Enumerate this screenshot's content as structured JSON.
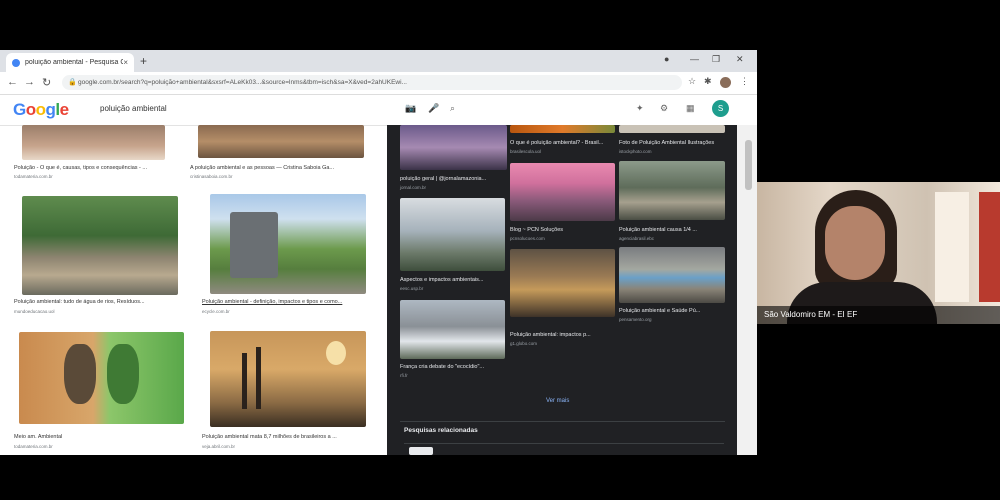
{
  "browser": {
    "tab_title": "poluição ambiental - Pesquisa G",
    "address": "google.com.br/search?q=poluição+ambiental&sxsrf=ALeKk03...&source=lnms&tbm=isch&sa=X&ved=2ahUKEwi...",
    "new_tab_symbol": "+",
    "close_symbol": "×"
  },
  "google": {
    "logo_letters": [
      "G",
      "o",
      "o",
      "g",
      "l",
      "e"
    ],
    "logo_colors": [
      "#4285f4",
      "#ea4335",
      "#fbbc05",
      "#4285f4",
      "#34a853",
      "#ea4335"
    ],
    "query": "poluição ambiental",
    "avatar_letter": "S"
  },
  "results_left": [
    {
      "caption": "Poluição - O que é, causas, tipos e consequências - ...",
      "source": "todamateria.com.br"
    },
    {
      "caption": "A poluição ambiental e as pessoas — Cristina Saboia Ga...",
      "source": "cristinasaboia.com.br"
    },
    {
      "caption": "Poluição ambiental: tudo de água de rios, Resíduos...",
      "source": "mundoeducacao.uol"
    },
    {
      "caption": "Poluição ambiental - definição, impactos e tipos e como...",
      "source": "ecycle.com.br"
    },
    {
      "caption": "Meio am. Ambiental",
      "source": "todamateria.com.br"
    },
    {
      "caption": "Poluição ambiental mata 8,7 milhões de brasileiros a ...",
      "source": "veja.abril.com.br"
    }
  ],
  "results_panel": [
    {
      "caption": "O que é poluição ambiental? - Brasil...",
      "source": "brasilescola.uol"
    },
    {
      "caption": "Foto de Poluição Ambiental Ilustrações",
      "source": "istockphoto.com"
    },
    {
      "caption": "poluição geral | @jornalamazonia...",
      "source": "jornal.com.br"
    },
    {
      "caption": "Blog ~ PCN Soluções",
      "source": "pcnsolucoes.com"
    },
    {
      "caption": "Poluição ambiental causa 1/4 ...",
      "source": "agenciabrasil.ebc"
    },
    {
      "caption": "Aspectos e impactos ambientais...",
      "source": "eesc.usp.br"
    },
    {
      "caption": "Poluição ambiental: impactos p...",
      "source": "g1.globo.com"
    },
    {
      "caption": "Poluição ambiental e Saúde Pú...",
      "source": "pensamento.org"
    },
    {
      "caption": "França cria debate do \"ecocídio\"...",
      "source": "rfi.fr"
    }
  ],
  "see_more": "Ver mais",
  "related_searches": "Pesquisas relacionadas",
  "video": {
    "participant": "São Valdomiro EM - EI EF"
  },
  "colors": {
    "panel_bg": "#202124",
    "browser_bg": "#ffffff",
    "avatar": "#1e9e8e"
  }
}
